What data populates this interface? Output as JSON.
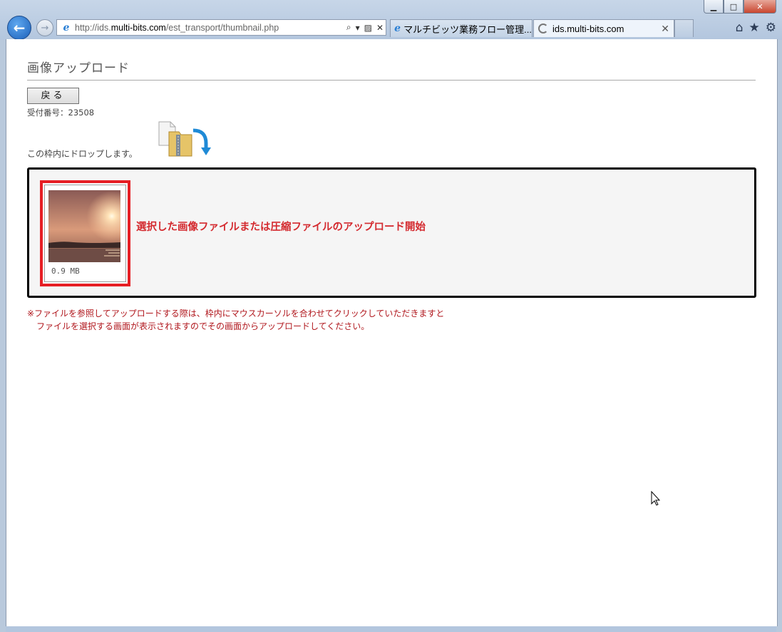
{
  "browser": {
    "back_label": "←",
    "forward_label": "→",
    "address": {
      "prefix": "http://ids.",
      "host": "multi-bits.com",
      "path": "/est_transport/thumbnail.php"
    },
    "tabs": [
      {
        "label": "マルチビッツ業務フロー管理..."
      },
      {
        "label": "ids.multi-bits.com"
      }
    ],
    "window_buttons": {
      "minimize": "▁",
      "maximize": "□",
      "close": "✕"
    },
    "tools": {
      "home": "⌂",
      "favorites": "★",
      "settings": "⚙"
    }
  },
  "page": {
    "title": "画像アップロード",
    "back_button": "戻る",
    "receipt_label": "受付番号：23508",
    "drop_hint": "この枠内にドロップします。",
    "thumbnail": {
      "size_label": "0.9 MB"
    },
    "upload_message": "選択した画像ファイルまたは圧縮ファイルのアップロード開始",
    "note_lines": [
      "※ファイルを参照してアップロードする際は、枠内にマウスカーソルを合わせてクリックしていただきますと",
      "ファイルを選択する画面が表示されますのでその画面からアップロードしてください。"
    ]
  },
  "colors": {
    "accent_red": "#d42a2f",
    "frame_red": "#e61e24",
    "chrome_blue": "#b9c9dc"
  }
}
